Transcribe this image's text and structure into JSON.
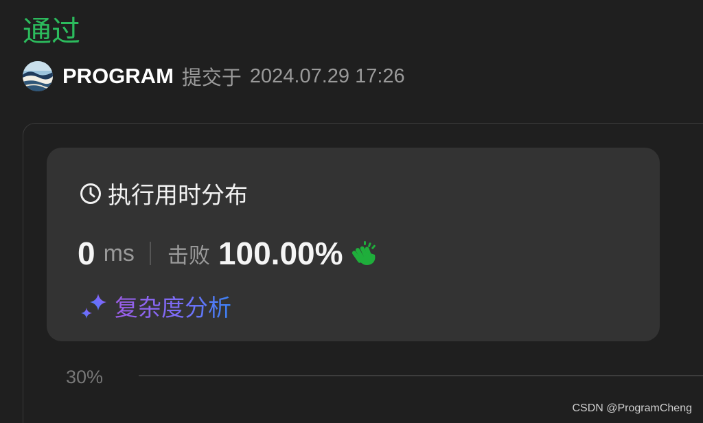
{
  "result": {
    "status": "通过",
    "status_color": "#2cbb5d"
  },
  "submission": {
    "username": "PROGRAM",
    "submitted_at_label": "提交于",
    "submitted_time": "2024.07.29 17:26"
  },
  "runtime_card": {
    "title": "执行用时分布",
    "title_icon": "clock-icon",
    "value": "0",
    "unit": "ms",
    "beat_label": "击败",
    "beat_value": "100.00%",
    "beat_icon": "clap-icon",
    "beat_icon_color": "#1fae3b",
    "analysis_label": "复杂度分析",
    "analysis_icon": "sparkle-icon"
  },
  "distribution_chart": {
    "y_tick_label": "30%"
  },
  "watermark": "CSDN @ProgramCheng"
}
